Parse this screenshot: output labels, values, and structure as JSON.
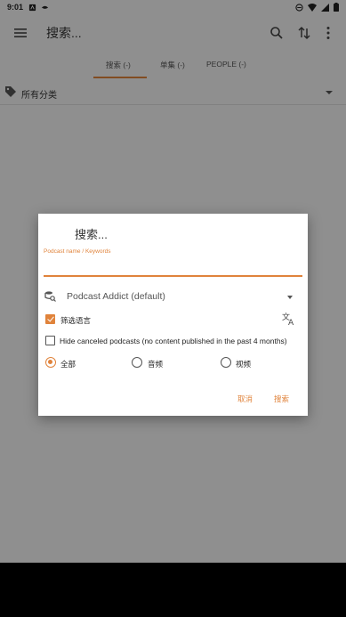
{
  "status_bar": {
    "time": "9:01",
    "left_icons": [
      "a-icon",
      "bird-icon"
    ],
    "right_icons": [
      "do-not-disturb-icon",
      "wifi-icon",
      "signal-icon",
      "battery-icon"
    ]
  },
  "toolbar": {
    "title": "搜索...",
    "icons": [
      "menu-icon",
      "search-icon",
      "sort-icon",
      "more-vert-icon"
    ]
  },
  "tabs": [
    {
      "label": "搜索 (-)",
      "active": true
    },
    {
      "label": "单集 (-)",
      "active": false
    },
    {
      "label": "PEOPLE (-)",
      "active": false
    }
  ],
  "category": {
    "label": "所有分类"
  },
  "dialog": {
    "search_hint": "搜索...",
    "field_label": "Podcast name / Keywords",
    "source": "Podcast Addict (default)",
    "filter_language": {
      "label": "筛选语言",
      "checked": true
    },
    "hide_canceled": {
      "label": "Hide canceled podcasts (no content published in the past 4 months)",
      "checked": false
    },
    "media_types": [
      {
        "label": "全部",
        "selected": true
      },
      {
        "label": "音频",
        "selected": false
      },
      {
        "label": "视频",
        "selected": false
      }
    ],
    "cancel_label": "取消",
    "search_label": "搜索"
  },
  "colors": {
    "accent": "#e0833b",
    "scrim": "#000000"
  }
}
